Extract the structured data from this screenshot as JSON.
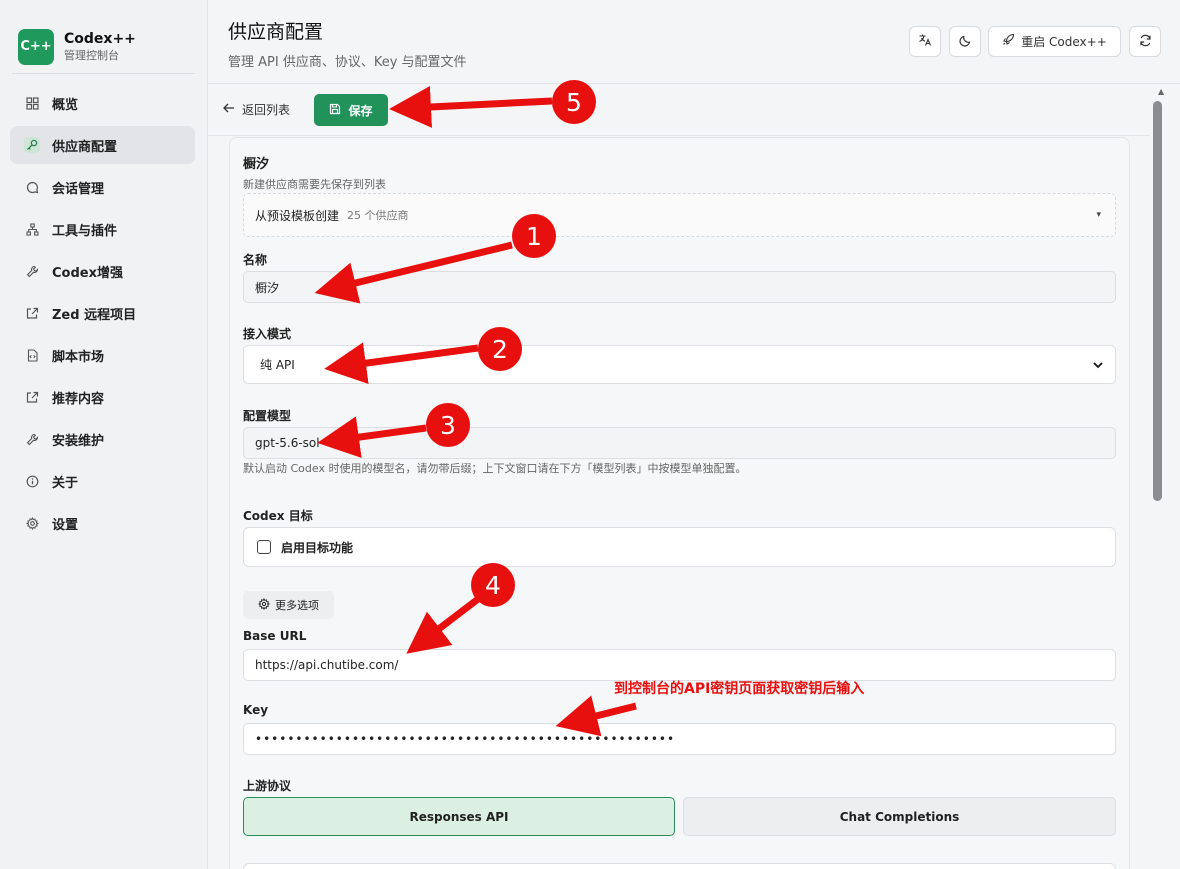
{
  "brand": {
    "logo": "C++",
    "name": "Codex++",
    "subtitle": "管理控制台"
  },
  "sidebar": {
    "items": [
      {
        "label": "概览",
        "icon": "grid-icon",
        "active": false
      },
      {
        "label": "供应商配置",
        "icon": "key-icon",
        "active": true
      },
      {
        "label": "会话管理",
        "icon": "chat-icon",
        "active": false
      },
      {
        "label": "工具与插件",
        "icon": "network-icon",
        "active": false
      },
      {
        "label": "Codex增强",
        "icon": "wrench-icon",
        "active": false
      },
      {
        "label": "Zed 远程项目",
        "icon": "external-link-icon",
        "active": false
      },
      {
        "label": "脚本市场",
        "icon": "file-code-icon",
        "active": false
      },
      {
        "label": "推荐内容",
        "icon": "external-link-icon",
        "active": false
      },
      {
        "label": "安装维护",
        "icon": "wrench-icon",
        "active": false
      },
      {
        "label": "关于",
        "icon": "info-icon",
        "active": false
      },
      {
        "label": "设置",
        "icon": "gear-icon",
        "active": false
      }
    ]
  },
  "header": {
    "title": "供应商配置",
    "subtitle": "管理 API 供应商、协议、Key 与配置文件",
    "restart_label": "重启 Codex++"
  },
  "toolbar": {
    "back_label": "返回列表",
    "save_label": "保存"
  },
  "form": {
    "provider_title": "橱汐",
    "provider_hint": "新建供应商需要先保存到列表",
    "preset_label": "从预设模板创建",
    "preset_count": "25 个供应商",
    "name_label": "名称",
    "name_value": "橱汐",
    "mode_label": "接入模式",
    "mode_value": "纯 API",
    "model_label": "配置模型",
    "model_value": "gpt-5.6-sol",
    "model_hint": "默认启动 Codex 时使用的模型名，请勿带后缀；上下文窗口请在下方「模型列表」中按模型单独配置。",
    "target_label": "Codex 目标",
    "target_checkbox_label": "启用目标功能",
    "more_options_label": "更多选项",
    "base_url_label": "Base URL",
    "base_url_value": "https://api.chutibe.com/",
    "key_label": "Key",
    "key_value": "••••••••••••••••••••••••••••••••••••••••••••••••••••",
    "protocol_label": "上游协议",
    "protocol_options": [
      "Responses API",
      "Chat Completions"
    ]
  },
  "annotations": {
    "badges": [
      "1",
      "2",
      "3",
      "4",
      "5"
    ],
    "key_note": "到控制台的API密钥页面获取密钥后输入",
    "color": "#e8100f"
  }
}
